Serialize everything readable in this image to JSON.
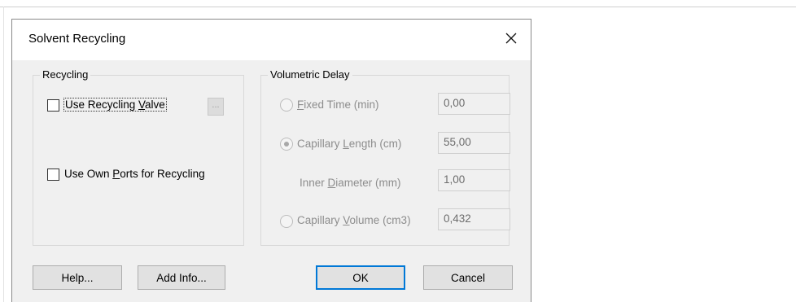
{
  "dialog": {
    "title": "Solvent Recycling",
    "close_symbol": "×"
  },
  "recycling_group": {
    "label": "Recycling",
    "use_valve": {
      "pre": "Use Recycling ",
      "accel": "V",
      "post": "alve",
      "checked": false
    },
    "ellipsis_label": "...",
    "use_own_ports": {
      "pre": "Use Own ",
      "accel": "P",
      "post": "orts for Recycling",
      "checked": false
    }
  },
  "delay_group": {
    "label": "Volumetric Delay",
    "fixed_time": {
      "pre": "",
      "accel": "F",
      "post": "ixed Time (min)",
      "value": "0,00",
      "selected": false
    },
    "capillary_length": {
      "pre": "Capillary ",
      "accel": "L",
      "post": "ength (cm)",
      "value": "55,00",
      "selected": true
    },
    "inner_diameter": {
      "pre": "Inner ",
      "accel": "D",
      "post": "iameter (mm)",
      "value": "1,00"
    },
    "capillary_volume": {
      "pre": "Capillary ",
      "accel": "V",
      "post": "olume (cm3)",
      "value": "0,432",
      "selected": false
    }
  },
  "buttons": {
    "help": "Help...",
    "add_info": "Add Info...",
    "ok": "OK",
    "cancel": "Cancel"
  }
}
